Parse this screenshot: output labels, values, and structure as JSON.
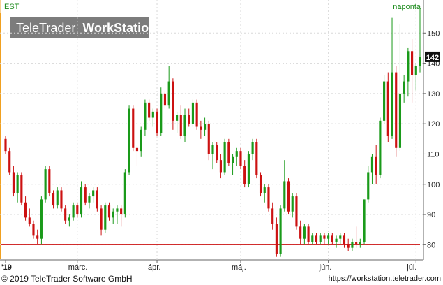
{
  "chart_data": {
    "type": "candlestick",
    "symbol": "EST",
    "frequency": "naponta",
    "watermark": "TeleTrader WorkStation",
    "watermark_parts": [
      "TeleTrader",
      "WorkStation"
    ],
    "last_price": "142",
    "ylim": [
      75,
      160
    ],
    "y_ticks": [
      80,
      90,
      100,
      110,
      120,
      130,
      140,
      150
    ],
    "x_ticks": [
      "'19",
      "márc.",
      "ápr.",
      "máj.",
      "jún.",
      "júl."
    ],
    "x_tick_index": [
      0,
      18,
      38,
      59,
      81,
      103
    ],
    "support_level": 80,
    "colors": {
      "up": "#1a9a1a",
      "down": "#cc1111",
      "support": "#cc1111",
      "last_bg": "#111111",
      "price_marker": "#f0a020"
    },
    "candles": [
      [
        115,
        116,
        110,
        111
      ],
      [
        111,
        112,
        103,
        104
      ],
      [
        104,
        106,
        96,
        97
      ],
      [
        97,
        104,
        94,
        103
      ],
      [
        103,
        104,
        93,
        94
      ],
      [
        94,
        96,
        88,
        89
      ],
      [
        89,
        92,
        86,
        87
      ],
      [
        87,
        88,
        82,
        83
      ],
      [
        83,
        85,
        80,
        82
      ],
      [
        82,
        96,
        80,
        95
      ],
      [
        95,
        106,
        94,
        105
      ],
      [
        105,
        106,
        96,
        97
      ],
      [
        97,
        98,
        92,
        93
      ],
      [
        93,
        99,
        92,
        98
      ],
      [
        98,
        99,
        91,
        92
      ],
      [
        92,
        93,
        87,
        88
      ],
      [
        88,
        90,
        86,
        89
      ],
      [
        89,
        94,
        88,
        93
      ],
      [
        93,
        94,
        89,
        90
      ],
      [
        90,
        101,
        89,
        99
      ],
      [
        99,
        100,
        93,
        94
      ],
      [
        94,
        97,
        92,
        96
      ],
      [
        96,
        99,
        94,
        98
      ],
      [
        98,
        99,
        91,
        92
      ],
      [
        92,
        93,
        83,
        85
      ],
      [
        85,
        94,
        84,
        93
      ],
      [
        93,
        94,
        88,
        89
      ],
      [
        89,
        92,
        87,
        91
      ],
      [
        91,
        93,
        87,
        92
      ],
      [
        92,
        93,
        86,
        90
      ],
      [
        90,
        105,
        89,
        104
      ],
      [
        104,
        126,
        103,
        125
      ],
      [
        125,
        126,
        111,
        112
      ],
      [
        112,
        113,
        106,
        111
      ],
      [
        111,
        119,
        109,
        118
      ],
      [
        118,
        128,
        116,
        127
      ],
      [
        127,
        128,
        121,
        122
      ],
      [
        122,
        125,
        119,
        124
      ],
      [
        124,
        125,
        116,
        117
      ],
      [
        117,
        132,
        116,
        130
      ],
      [
        130,
        131,
        125,
        126
      ],
      [
        126,
        139,
        125,
        134
      ],
      [
        134,
        135,
        118,
        121
      ],
      [
        121,
        124,
        117,
        123
      ],
      [
        123,
        126,
        115,
        116
      ],
      [
        116,
        125,
        114,
        123
      ],
      [
        123,
        125,
        119,
        120
      ],
      [
        120,
        128,
        119,
        127
      ],
      [
        127,
        128,
        118,
        119
      ],
      [
        119,
        121,
        115,
        118
      ],
      [
        118,
        122,
        116,
        120
      ],
      [
        120,
        121,
        108,
        110
      ],
      [
        110,
        114,
        105,
        113
      ],
      [
        113,
        114,
        107,
        108
      ],
      [
        108,
        110,
        102,
        104
      ],
      [
        104,
        115,
        103,
        114
      ],
      [
        114,
        115,
        106,
        107
      ],
      [
        107,
        110,
        103,
        109
      ],
      [
        109,
        112,
        106,
        111
      ],
      [
        111,
        112,
        105,
        106
      ],
      [
        106,
        108,
        99,
        100
      ],
      [
        100,
        111,
        99,
        110
      ],
      [
        110,
        115,
        108,
        114
      ],
      [
        114,
        115,
        102,
        103
      ],
      [
        103,
        104,
        96,
        97
      ],
      [
        97,
        100,
        94,
        99
      ],
      [
        99,
        100,
        91,
        92
      ],
      [
        92,
        94,
        85,
        87
      ],
      [
        87,
        89,
        76,
        77
      ],
      [
        77,
        93,
        76,
        92
      ],
      [
        92,
        108,
        91,
        101
      ],
      [
        101,
        102,
        90,
        91
      ],
      [
        91,
        97,
        89,
        96
      ],
      [
        96,
        97,
        85,
        86
      ],
      [
        86,
        88,
        80,
        82
      ],
      [
        82,
        87,
        80,
        86
      ],
      [
        86,
        87,
        80,
        81
      ],
      [
        81,
        84,
        80,
        83
      ],
      [
        83,
        84,
        80,
        81
      ],
      [
        81,
        84,
        80,
        83
      ],
      [
        83,
        84,
        80,
        82
      ],
      [
        82,
        84,
        80,
        83
      ],
      [
        83,
        84,
        80,
        81
      ],
      [
        81,
        83,
        79,
        82
      ],
      [
        82,
        84,
        80,
        83
      ],
      [
        83,
        84,
        79,
        80
      ],
      [
        80,
        82,
        78,
        79
      ],
      [
        79,
        82,
        78,
        81
      ],
      [
        81,
        86,
        79,
        80
      ],
      [
        80,
        82,
        79,
        81
      ],
      [
        81,
        95,
        80,
        95
      ],
      [
        95,
        106,
        94,
        104
      ],
      [
        104,
        110,
        100,
        109
      ],
      [
        109,
        113,
        100,
        103
      ],
      [
        103,
        122,
        102,
        121
      ],
      [
        121,
        136,
        120,
        134
      ],
      [
        134,
        137,
        114,
        116
      ],
      [
        116,
        155,
        115,
        137
      ],
      [
        137,
        139,
        109,
        112
      ],
      [
        112,
        153,
        111,
        130
      ],
      [
        130,
        136,
        127,
        134
      ],
      [
        134,
        145,
        129,
        144
      ],
      [
        144,
        148,
        127,
        136
      ],
      [
        136,
        140,
        131,
        139
      ],
      [
        139,
        158,
        137,
        142
      ]
    ]
  },
  "footer": {
    "copyright": "© 2019 TeleTrader Software GmbH",
    "url": "https://workstation.teletrader.com"
  }
}
